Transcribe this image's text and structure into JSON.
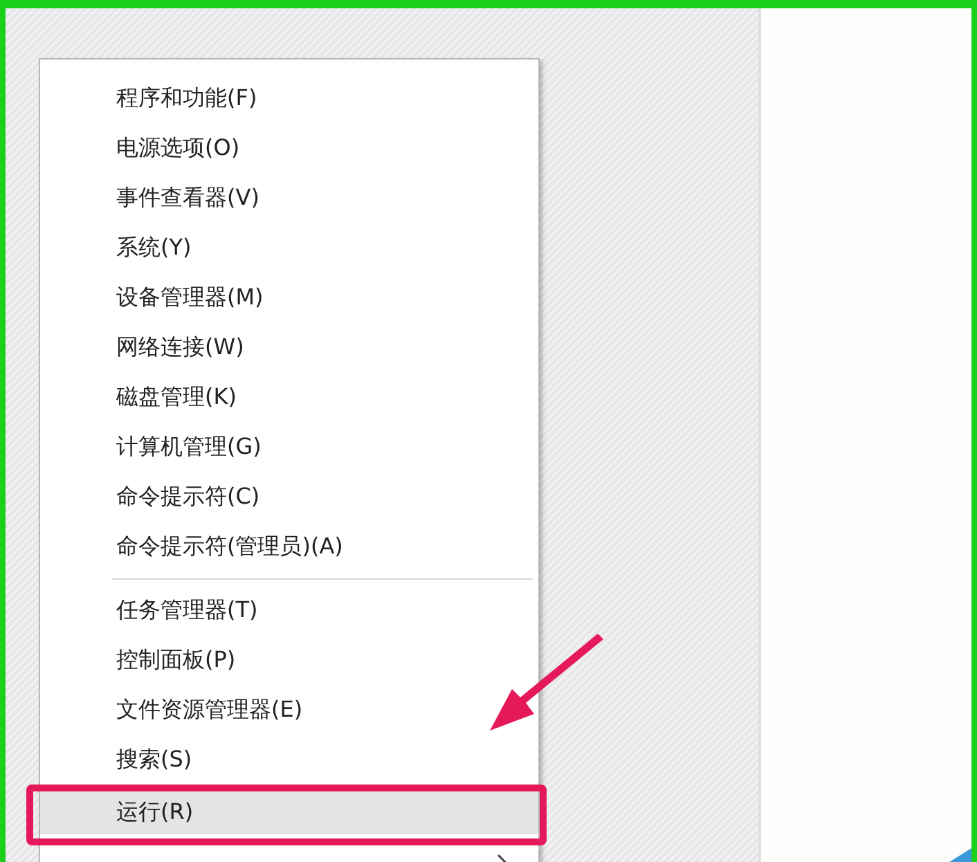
{
  "menu": {
    "items": [
      {
        "kind": "item",
        "label": "程序和功能(F)",
        "selected": false
      },
      {
        "kind": "item",
        "label": "电源选项(O)",
        "selected": false
      },
      {
        "kind": "item",
        "label": "事件查看器(V)",
        "selected": false
      },
      {
        "kind": "item",
        "label": "系统(Y)",
        "selected": false
      },
      {
        "kind": "item",
        "label": "设备管理器(M)",
        "selected": false
      },
      {
        "kind": "item",
        "label": "网络连接(W)",
        "selected": false
      },
      {
        "kind": "item",
        "label": "磁盘管理(K)",
        "selected": false
      },
      {
        "kind": "item",
        "label": "计算机管理(G)",
        "selected": false
      },
      {
        "kind": "item",
        "label": "命令提示符(C)",
        "selected": false
      },
      {
        "kind": "item",
        "label": "命令提示符(管理员)(A)",
        "selected": false
      },
      {
        "kind": "separator"
      },
      {
        "kind": "item",
        "label": "任务管理器(T)",
        "selected": false
      },
      {
        "kind": "item",
        "label": "控制面板(P)",
        "selected": false
      },
      {
        "kind": "item",
        "label": "文件资源管理器(E)",
        "selected": false
      },
      {
        "kind": "item",
        "label": "搜索(S)",
        "selected": false
      },
      {
        "kind": "item",
        "label": "运行(R)",
        "selected": true
      },
      {
        "kind": "submenu"
      }
    ]
  }
}
